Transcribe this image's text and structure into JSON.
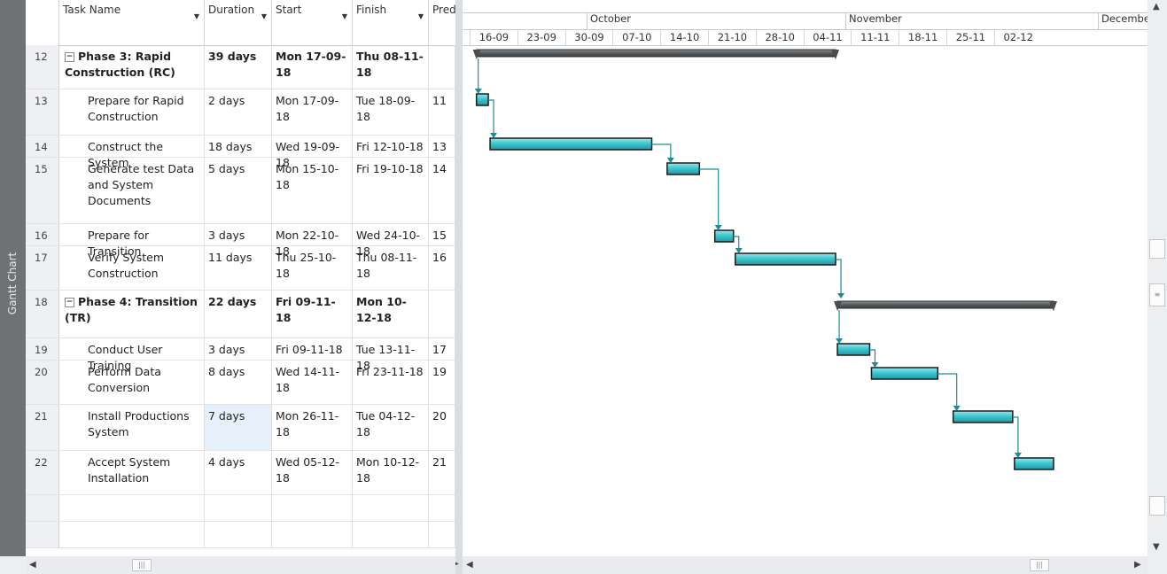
{
  "view_label": "Gantt Chart",
  "columns": {
    "task_name": "Task Name",
    "duration": "Duration",
    "start": "Start",
    "finish": "Finish",
    "predecessors": "Prede"
  },
  "months": [
    "October",
    "November",
    "December"
  ],
  "weeks": [
    "16-09",
    "23-09",
    "30-09",
    "07-10",
    "14-10",
    "21-10",
    "28-10",
    "04-11",
    "11-11",
    "18-11",
    "25-11",
    "02-12"
  ],
  "tasks": [
    {
      "id": "12",
      "name": "Phase 3: Rapid Construction (RC)",
      "duration": "39 days",
      "start": "Mon 17-09-18",
      "finish": "Thu 08-11-18",
      "pred": ""
    },
    {
      "id": "13",
      "name": "Prepare for Rapid Construction",
      "duration": "2 days",
      "start": "Mon 17-09-18",
      "finish": "Tue 18-09-18",
      "pred": "11"
    },
    {
      "id": "14",
      "name": "Construct the System",
      "duration": "18 days",
      "start": "Wed 19-09-18",
      "finish": "Fri 12-10-18",
      "pred": "13"
    },
    {
      "id": "15",
      "name": "Generate test Data and System Documents",
      "duration": "5 days",
      "start": "Mon 15-10-18",
      "finish": "Fri 19-10-18",
      "pred": "14"
    },
    {
      "id": "16",
      "name": "Prepare for Transition",
      "duration": "3 days",
      "start": "Mon 22-10-18",
      "finish": "Wed 24-10-18",
      "pred": "15"
    },
    {
      "id": "17",
      "name": "Verify System Construction",
      "duration": "11 days",
      "start": "Thu 25-10-18",
      "finish": "Thu 08-11-18",
      "pred": "16"
    },
    {
      "id": "18",
      "name": "Phase 4: Transition (TR)",
      "duration": "22 days",
      "start": "Fri 09-11-18",
      "finish": "Mon 10-12-18",
      "pred": ""
    },
    {
      "id": "19",
      "name": "Conduct User Training",
      "duration": "3 days",
      "start": "Fri 09-11-18",
      "finish": "Tue 13-11-18",
      "pred": "17"
    },
    {
      "id": "20",
      "name": "Perform Data Conversion",
      "duration": "8 days",
      "start": "Wed 14-11-18",
      "finish": "Fri 23-11-18",
      "pred": "19"
    },
    {
      "id": "21",
      "name": "Install Productions System",
      "duration": "7 days",
      "start": "Mon 26-11-18",
      "finish": "Tue 04-12-18",
      "pred": "20"
    },
    {
      "id": "22",
      "name": "Accept System Installation",
      "duration": "4 days",
      "start": "Wed 05-12-18",
      "finish": "Mon 10-12-18",
      "pred": "21"
    }
  ],
  "colors": {
    "task_bar": "#3fc6cf",
    "summary_bar": "#585b5e",
    "link": "#1f8a96"
  }
}
